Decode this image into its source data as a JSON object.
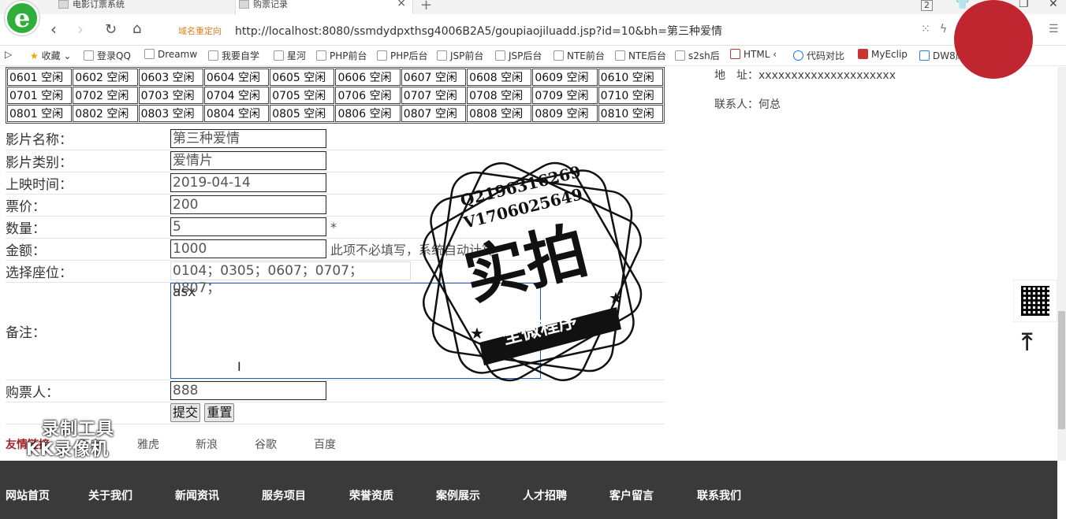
{
  "browser": {
    "tabs": [
      {
        "title": "电影订票系统"
      },
      {
        "title": "购票记录"
      }
    ],
    "tab_count_badge": "2",
    "redirect_label": "域名重定向",
    "url": "http://localhost:8080/ssmdydpxthsg4006B2A5/goupiaojiluadd.jsp?id=10&bh=第三种爱情",
    "bookmarks": [
      "收藏",
      "登录QQ",
      "Dreamw",
      "我要自学",
      "星河",
      "PHP前台",
      "PHP后台",
      "JSP前台",
      "JSP后台",
      "NTE前台",
      "NTE后台",
      "s2sh后",
      "HTML",
      "代码对比",
      "MyEclip",
      "DW8库"
    ]
  },
  "seats": [
    [
      "0601 空闲",
      "0602 空闲",
      "0603 空闲",
      "0604 空闲",
      "0605 空闲",
      "0606 空闲",
      "0607 空闲",
      "0608 空闲",
      "0609 空闲",
      "0610 空闲"
    ],
    [
      "0701 空闲",
      "0702 空闲",
      "0703 空闲",
      "0704 空闲",
      "0705 空闲",
      "0706 空闲",
      "0707 空闲",
      "0708 空闲",
      "0709 空闲",
      "0710 空闲"
    ],
    [
      "0801 空闲",
      "0802 空闲",
      "0803 空闲",
      "0804 空闲",
      "0805 空闲",
      "0806 空闲",
      "0807 空闲",
      "0808 空闲",
      "0809 空闲",
      "0810 空闲"
    ]
  ],
  "form": {
    "movie_name_label": "影片名称：",
    "movie_name": "第三种爱情",
    "category_label": "影片类别：",
    "category": "爱情片",
    "release_label": "上映时间：",
    "release": "2019-04-14",
    "price_label": "票价：",
    "price": "200",
    "qty_label": "数量：",
    "qty": "5",
    "required_mark": "*",
    "amount_label": "金额：",
    "amount": "1000",
    "amount_hint": "此项不必填写，系统自动计算",
    "seat_label": "选择座位：",
    "seat_value": "0104；0305；0607；0707；0807；",
    "remark_label": "备注：",
    "remark": "asx",
    "buyer_label": "购票人：",
    "buyer": "888",
    "submit": "提交",
    "reset": "重置"
  },
  "side": {
    "address": "地　址：xxxxxxxxxxxxxxxxxxxxx",
    "contact": "联系人：何总"
  },
  "friend_links": {
    "title": "友情链接",
    "items": [
      "百度",
      "雅虎",
      "新浪",
      "谷歌",
      "百度"
    ]
  },
  "footer": [
    "网站首页",
    "关于我们",
    "新闻资讯",
    "服务项目",
    "荣誉资质",
    "案例展示",
    "人才招聘",
    "客户留言",
    "联系我们"
  ],
  "watermarks": {
    "recorder_line1": "录制工具",
    "recorder_line2": "KK录像机",
    "stamp_q": "Q2196316269",
    "stamp_v": "V1706025649",
    "stamp_main": "实拍",
    "stamp_band": "全微程序"
  }
}
